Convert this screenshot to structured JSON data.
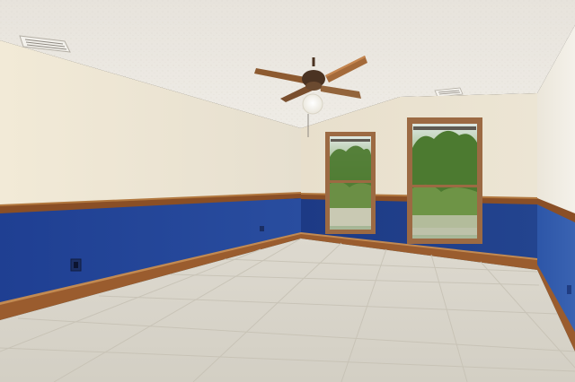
{
  "scene": {
    "kind": "empty room interior photo",
    "colors": {
      "ceiling": "#eae6df",
      "wall_upper": "#e9e2d2",
      "wall_lower": "#24489a",
      "chair_rail": "#8a4f26",
      "baseboard": "#9a5c2e",
      "floor": "#d7d3c8",
      "floor_grout": "#c4bfb2",
      "window_frame": "#9c6a43",
      "fan_blade": "#a46a3a",
      "fan_light": "#fbfaf5",
      "foliage": "#4f7b33"
    }
  }
}
